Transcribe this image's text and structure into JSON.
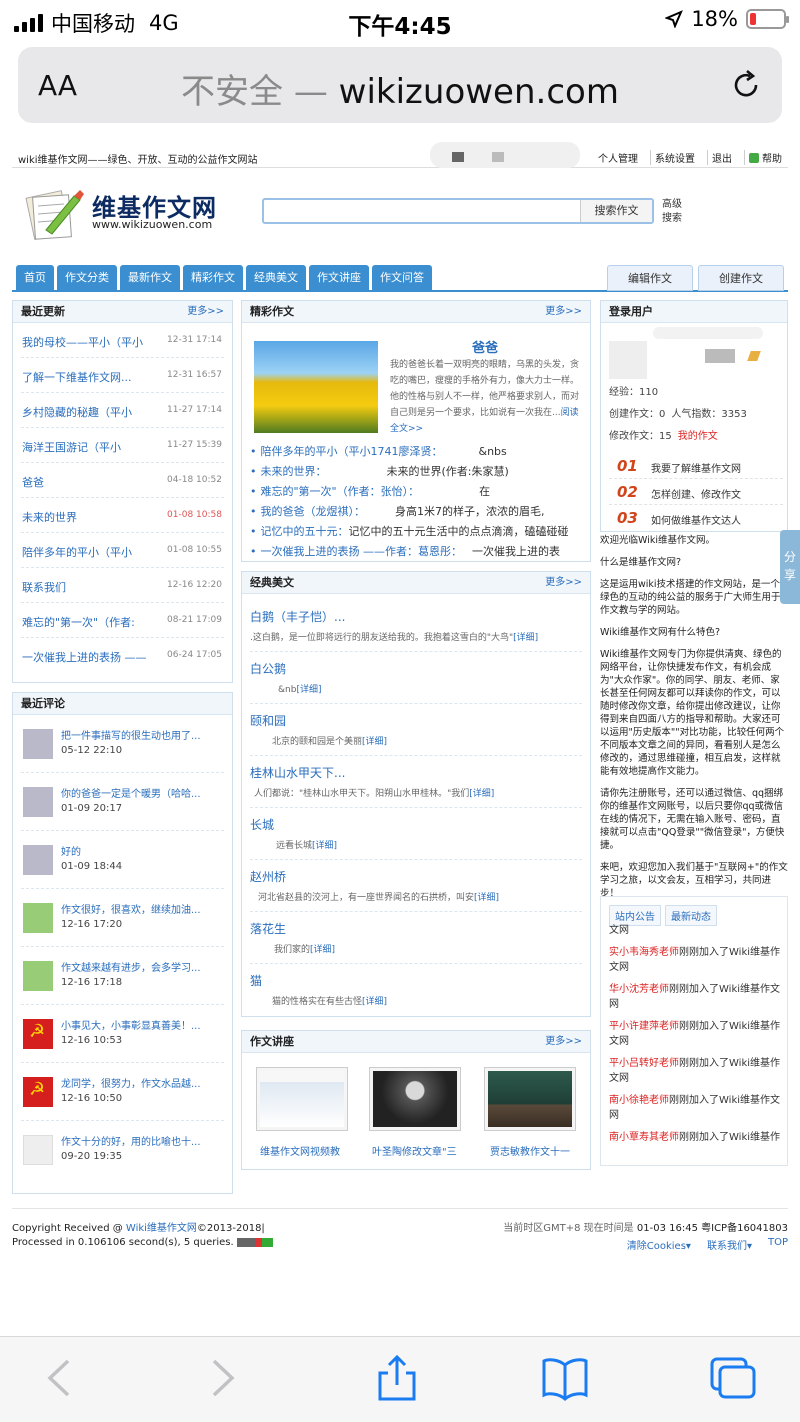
{
  "status_bar": {
    "carrier": "中国移动",
    "network": "4G",
    "time": "下午4:45",
    "battery": "18%"
  },
  "browser": {
    "aa": "AA",
    "not_secure": "不安全 —",
    "domain": "wikizuowen.com"
  },
  "topbar": {
    "slogan": "wiki维基作文网——绿色、开放、互动的公益作文网站",
    "links": [
      "个人管理",
      "系统设置",
      "退出",
      "帮助"
    ]
  },
  "header": {
    "site_name": "维基作文网",
    "site_url": "www.wikizuowen.com",
    "search_button": "搜索作文",
    "advanced_1": "高级",
    "advanced_2": "搜索"
  },
  "nav": {
    "tabs": [
      "首页",
      "作文分类",
      "最新作文",
      "精彩作文",
      "经典美文",
      "作文讲座",
      "作文问答"
    ],
    "edit": "编辑作文",
    "create": "创建作文"
  },
  "recent_updates": {
    "title": "最近更新",
    "more": "更多>>",
    "items": [
      {
        "title": "我的母校——平小（平小",
        "date": "12-31 17:14"
      },
      {
        "title": "了解一下维基作文网...",
        "date": "12-31 16:57"
      },
      {
        "title": "乡村隐藏的秘趣（平小",
        "date": "11-27 17:14"
      },
      {
        "title": "海洋王国游记（平小",
        "date": "11-27 15:39"
      },
      {
        "title": "爸爸",
        "date": "04-18 10:52"
      },
      {
        "title": "未来的世界",
        "date": "01-08 10:58"
      },
      {
        "title": "陪伴多年的平小（平小",
        "date": "01-08 10:55"
      },
      {
        "title": "联系我们",
        "date": "12-16 12:20"
      },
      {
        "title": "难忘的\"第一次\"（作者:",
        "date": "08-21 17:09"
      },
      {
        "title": "一次催我上进的表扬 ——",
        "date": "06-24 17:05"
      }
    ]
  },
  "recent_comments": {
    "title": "最近评论",
    "items": [
      {
        "text": "把一件事描写的很生动也用了...",
        "time": "05-12 22:10"
      },
      {
        "text": "你的爸爸一定是个暖男（哈哈...",
        "time": "01-09 20:17"
      },
      {
        "text": "好的",
        "time": "01-09 18:44"
      },
      {
        "text": "作文很好，很喜欢，继续加油...",
        "time": "12-16 17:20"
      },
      {
        "text": "作文越来越有进步，会多学习...",
        "time": "12-16 17:18"
      },
      {
        "text": "小事见大，小事彰显真善美！...",
        "time": "12-16 10:53"
      },
      {
        "text": "龙同学，很努力，作文水品越...",
        "time": "12-16 10:50"
      },
      {
        "text": "作文十分的好，用的比喻也十...",
        "time": "09-20 19:35"
      }
    ]
  },
  "featured": {
    "title": "精彩作文",
    "more": "更多>>",
    "article_title": "爸爸",
    "article_excerpt": "我的爸爸长着一双明亮的眼睛，乌黑的头发，贪吃的嘴巴，瘦瘦的手格外有力，像大力士一样。他的性格与别人不一样，他严格要求别人，而对自己则是另一个要求，比如说有一次我在...",
    "read_full": "阅读全文>>",
    "list": [
      {
        "link": "陪伴多年的平小（平小1741廖泽贤：",
        "summary": "&nbs"
      },
      {
        "link": "未来的世界：",
        "summary": "未来的世界(作者:朱家慧)"
      },
      {
        "link": "难忘的\"第一次\"（作者：张怡）：",
        "summary": "在"
      },
      {
        "link": "我的爸爸（龙煜祺）：",
        "summary": "身高1米7的样子，浓浓的眉毛,"
      },
      {
        "link": "记忆中的五十元：",
        "summary": "记忆中的五十元生活中的点点滴滴，磕磕碰碰"
      },
      {
        "link": "一次催我上进的表扬 ——作者：葛恩彤：",
        "summary": "一次催我上进的表"
      }
    ]
  },
  "classics": {
    "title": "经典美文",
    "more": "更多>>",
    "detail": "[详细]",
    "items": [
      {
        "title": "白鹅（丰子恺）...",
        "desc": ".这白鹅，是一位即将远行的朋友送给我的。我抱着这雪白的\"大鸟\""
      },
      {
        "title": "白公鹅",
        "desc": "&nb"
      },
      {
        "title": "颐和园",
        "desc": "北京的颐和园是个美丽"
      },
      {
        "title": "桂林山水甲天下...",
        "desc": "人们都说：\"桂林山水甲天下。阳朔山水甲桂林。\"我们"
      },
      {
        "title": "长城",
        "desc": "远看长城"
      },
      {
        "title": "赵州桥",
        "desc": "河北省赵县的洨河上，有一座世界闻名的石拱桥，叫安"
      },
      {
        "title": "落花生",
        "desc": "我们家的"
      },
      {
        "title": "猫",
        "desc": "猫的性格实在有些古怪"
      }
    ]
  },
  "lectures": {
    "title": "作文讲座",
    "more": "更多>>",
    "items": [
      "维基作文网视频教",
      "叶圣陶修改文章\"三",
      "贾志敏教作文十一"
    ]
  },
  "login_user": {
    "title": "登录用户",
    "exp_label": "经验：",
    "exp": "110",
    "created_label": "创建作文：",
    "created": "0",
    "popularity_label": "人气指数：",
    "popularity": "3353",
    "modified_label": "修改作文：",
    "modified": "15",
    "my_articles": "我的作文"
  },
  "help_steps": [
    {
      "num": "01",
      "text": "我要了解维基作文网"
    },
    {
      "num": "02",
      "text": "怎样创建、修改作文"
    },
    {
      "num": "03",
      "text": "如何做维基作文达人"
    }
  ],
  "intro": {
    "p1": "欢迎光临Wiki维基作文网。",
    "p2": "什么是维基作文网?",
    "p3": "这是运用wiki技术搭建的作文网站，是一个绿色的互动的纯公益的服务于广大师生用于作文教与学的网站。",
    "p4": "Wiki维基作文网有什么特色?",
    "p5": "Wiki维基作文网专门为你提供清爽、绿色的网络平台，让你快捷发布作文，有机会成为\"大众作家\"。你的同学、朋友、老师、家长甚至任何网友都可以拜读你的作文，可以随时修改你文章，给你提出修改建议，让你得到来自四面八方的指导和帮助。大家还可以运用\"历史版本\"\"对比功能，比较任何两个不同版本文章之间的异同，看看别人是怎么修改的，通过思维碰撞，相互启发，这样就能有效地提高作文能力。",
    "p6": "请你先注册账号，还可以通过微信、qq捆绑你的维基作文网账号，以后只要你qq或微信在线的情况下，无需在输入账号、密码，直接就可以点击\"QQ登录\"\"微信登录\"，方便快捷。",
    "p7": "来吧，欢迎您加入我们基于\"互联网+\"的作文学习之旅，以文会友，互相学习，共同进步！"
  },
  "news": {
    "tabs": [
      "站内公告",
      "最新动态"
    ],
    "first": "文网",
    "items": [
      {
        "name": "实小韦海秀老师",
        "text": "刚刚加入了Wiki维基作文网"
      },
      {
        "name": "华小沈芳老师",
        "text": "刚刚加入了Wiki维基作文网"
      },
      {
        "name": "平小许建萍老师",
        "text": "刚刚加入了Wiki维基作文网"
      },
      {
        "name": "平小吕转好老师",
        "text": "刚刚加入了Wiki维基作文网"
      },
      {
        "name": "南小徐艳老师",
        "text": "刚刚加入了Wiki维基作文网"
      },
      {
        "name": "南小覃寿其老师",
        "text": "刚刚加入了Wiki维基作"
      }
    ]
  },
  "share": "分享",
  "footer": {
    "copyright_prefix": "Copyright Received @",
    "copyright_link": "Wiki维基作文网",
    "copyright_suffix": "©2013-2018|",
    "processed": "Processed in 0.106106 second(s), 5 queries.",
    "timezone": "当前时区GMT+8 现在时间是",
    "now": "01-03 16:45",
    "icp": "粤ICP备16041803",
    "clear_cookies": "清除Cookies",
    "contact": "联系我们",
    "top": "TOP"
  },
  "colors": {
    "nav_blue": "#3b8fd1",
    "link_blue": "#2a6ebc",
    "accent_red": "#d0451b"
  }
}
